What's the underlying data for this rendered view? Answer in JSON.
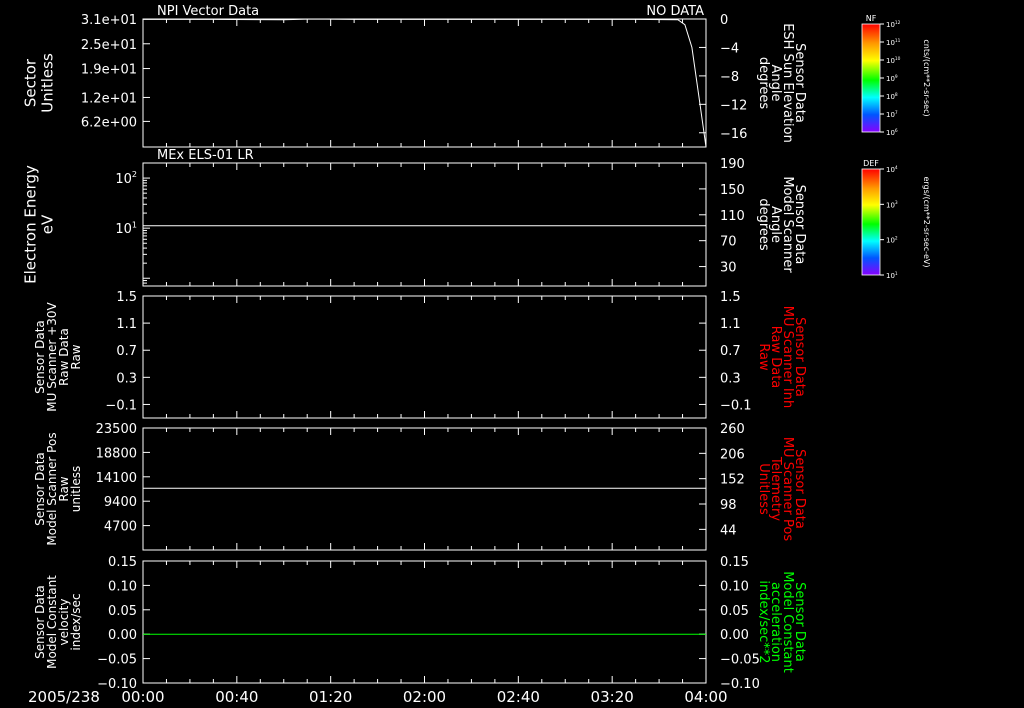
{
  "date_label": "2005/238",
  "time_ticks": [
    "00:00",
    "00:40",
    "01:20",
    "02:00",
    "02:40",
    "03:20",
    "04:00"
  ],
  "colors": {
    "background": "#000000",
    "foreground": "#ffffff",
    "red": "#ff0000",
    "green": "#00ff00"
  },
  "chart_data": [
    {
      "type": "line",
      "title": "NPI Vector Data",
      "status": "NO DATA",
      "ylabel": [
        "Sector",
        "Unitless"
      ],
      "y_tick_labels": [
        "3.1e+01",
        "2.5e+01",
        "1.9e+01",
        "1.2e+01",
        "6.2e+00"
      ],
      "y_ticks": [
        31,
        25,
        19,
        12,
        6.2
      ],
      "ylim": [
        0,
        31
      ],
      "right_ylabel": [
        "Sensor Data",
        "ESH Sun Elevation",
        "Angle",
        "degrees"
      ],
      "right_tick_labels": [
        "0",
        "−4",
        "−8",
        "−12",
        "−16"
      ],
      "right_ticks": [
        0,
        -4,
        -8,
        -12,
        -16
      ],
      "right_ylim": [
        -18,
        0
      ],
      "right_color": "#ffffff",
      "series": [
        {
          "axis": "right",
          "color": "#ffffff",
          "x_hours": [
            0.0,
            0.5,
            1.0,
            1.2,
            1.5,
            2.0,
            2.5,
            3.0,
            3.5,
            3.8,
            3.85,
            3.9,
            3.95,
            4.0
          ],
          "y": [
            -0.05,
            -0.05,
            -0.1,
            0.0,
            -0.05,
            -0.05,
            -0.05,
            -0.05,
            -0.05,
            -0.1,
            -0.8,
            -4,
            -11,
            -18
          ]
        }
      ]
    },
    {
      "type": "line",
      "title": "MEx ELS-01 LR",
      "ylabel": [
        "Electron Energy",
        "eV"
      ],
      "yscale": "log",
      "y_tick_labels": [
        {
          "base": "10",
          "exp": "2",
          "value": 100
        },
        {
          "base": "10",
          "exp": "1",
          "value": 10
        }
      ],
      "ylim": [
        0.7,
        200
      ],
      "right_ylabel": [
        "Sensor Data",
        "Model Scanner",
        "Angle",
        "degrees"
      ],
      "right_tick_labels": [
        "190",
        "150",
        "110",
        "70",
        "30"
      ],
      "right_ticks": [
        190,
        150,
        110,
        70,
        30
      ],
      "right_ylim": [
        0,
        190
      ],
      "right_color": "#ffffff",
      "series": [
        {
          "axis": "right",
          "color": "#ffffff",
          "x_hours": [
            0,
            4
          ],
          "y": [
            93,
            93
          ]
        }
      ]
    },
    {
      "type": "line",
      "ylabel": [
        "Sensor Data",
        "MU Scanner +30V",
        "Raw Data",
        "Raw"
      ],
      "y_tick_labels": [
        "1.5",
        "1.1",
        "0.7",
        "0.3",
        "−0.1"
      ],
      "y_ticks": [
        1.5,
        1.1,
        0.7,
        0.3,
        -0.1
      ],
      "ylim": [
        -0.3,
        1.5
      ],
      "right_ylabel": [
        "Sensor Data",
        "MU Scanner Inh",
        "Raw Data",
        "Raw"
      ],
      "right_tick_labels": [
        "1.5",
        "1.1",
        "0.7",
        "0.3",
        "−0.1"
      ],
      "right_ticks": [
        1.5,
        1.1,
        0.7,
        0.3,
        -0.1
      ],
      "right_ylim": [
        -0.3,
        1.5
      ],
      "right_color": "#ff0000",
      "series": []
    },
    {
      "type": "line",
      "ylabel": [
        "Sensor Data",
        "Model Scanner Pos",
        "Raw",
        "unitless"
      ],
      "y_tick_labels": [
        "23500",
        "18800",
        "14100",
        "9400",
        "4700"
      ],
      "y_ticks": [
        23500,
        18800,
        14100,
        9400,
        4700
      ],
      "ylim": [
        0,
        23500
      ],
      "right_ylabel": [
        "Sensor Data",
        "MU Scanner Pos",
        "Telemetry",
        "Unitless"
      ],
      "right_tick_labels": [
        "260",
        "206",
        "152",
        "98",
        "44"
      ],
      "right_ticks": [
        260,
        206,
        152,
        98,
        44
      ],
      "right_ylim": [
        0,
        260
      ],
      "right_color": "#ff0000",
      "series": [
        {
          "axis": "left",
          "color": "#ffffff",
          "x_hours": [
            0,
            4
          ],
          "y": [
            11900,
            11900
          ]
        }
      ]
    },
    {
      "type": "line",
      "ylabel": [
        "Sensor Data",
        "Model Constant",
        "velocity",
        "index/sec"
      ],
      "y_tick_labels": [
        "0.15",
        "0.10",
        "0.05",
        "0.00",
        "−0.05",
        "−0.10"
      ],
      "y_ticks": [
        0.15,
        0.1,
        0.05,
        0.0,
        -0.05,
        -0.1
      ],
      "ylim": [
        -0.1,
        0.15
      ],
      "right_ylabel": [
        "Sensor Data",
        "Model Constant",
        "acceleration",
        "index/sec**2"
      ],
      "right_tick_labels": [
        "0.15",
        "0.10",
        "0.05",
        "0.00",
        "−0.05",
        "−0.10"
      ],
      "right_ticks": [
        0.15,
        0.1,
        0.05,
        0.0,
        -0.05,
        -0.1
      ],
      "right_ylim": [
        -0.1,
        0.15
      ],
      "right_color": "#00ff00",
      "series": [
        {
          "axis": "left",
          "color": "#00ff00",
          "x_hours": [
            0,
            4
          ],
          "y": [
            0,
            0
          ]
        }
      ]
    }
  ],
  "colorbars": [
    {
      "name": "NF",
      "label": "cnts/(cm**2-sr-sec)",
      "ticks": [
        {
          "base": "10",
          "exp": "12"
        },
        {
          "base": "10",
          "exp": "11"
        },
        {
          "base": "10",
          "exp": "10"
        },
        {
          "base": "10",
          "exp": "9"
        },
        {
          "base": "10",
          "exp": "8"
        },
        {
          "base": "10",
          "exp": "7"
        },
        {
          "base": "10",
          "exp": "6"
        }
      ]
    },
    {
      "name": "DEF",
      "label": "ergs/(cm**2-sr-sec-eV)",
      "ticks": [
        {
          "base": "10",
          "exp": "4"
        },
        {
          "base": "10",
          "exp": "3"
        },
        {
          "base": "10",
          "exp": "2"
        },
        {
          "base": "10",
          "exp": "1"
        }
      ]
    }
  ]
}
